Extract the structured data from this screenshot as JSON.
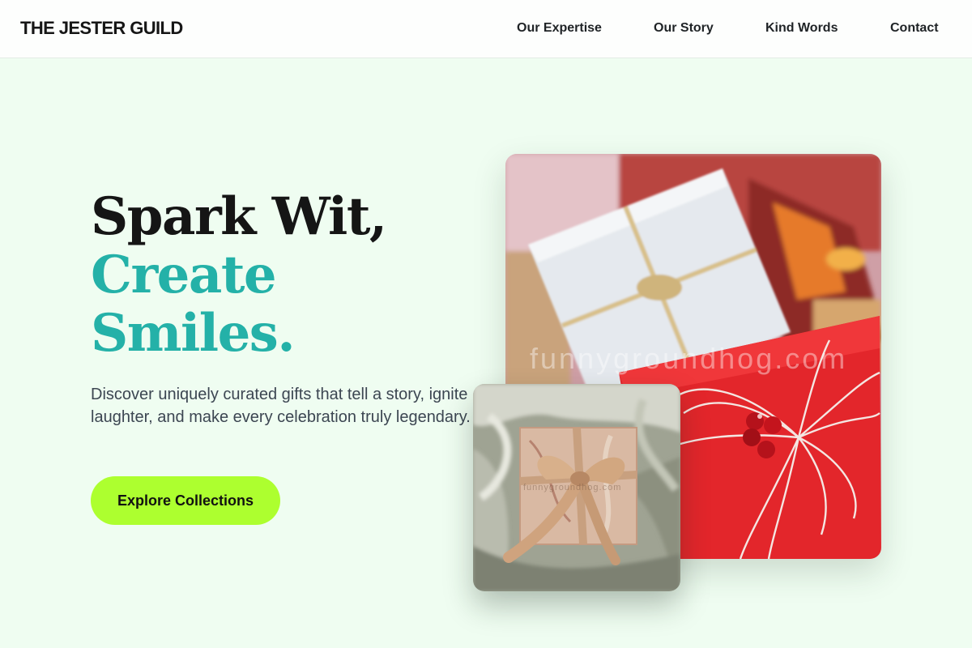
{
  "header": {
    "brand": "THE JESTER GUILD",
    "nav": [
      "Our Expertise",
      "Our Story",
      "Kind Words",
      "Contact"
    ]
  },
  "hero": {
    "headline": [
      "Spark Wit,",
      "Create",
      "Smiles."
    ],
    "tagline": "Discover uniquely curated gifts that tell a story, ignite laughter, and make every celebration truly legendary.",
    "cta_label": "Explore Collections"
  },
  "images": {
    "main_watermark": "funnygroundhog.com",
    "small_watermark": "funnygroundhog.com"
  },
  "colors": {
    "page_background": "#effdf1",
    "accent_teal": "#24b1a8",
    "cta_lime": "#adff2f",
    "headline_dark": "#151515"
  }
}
